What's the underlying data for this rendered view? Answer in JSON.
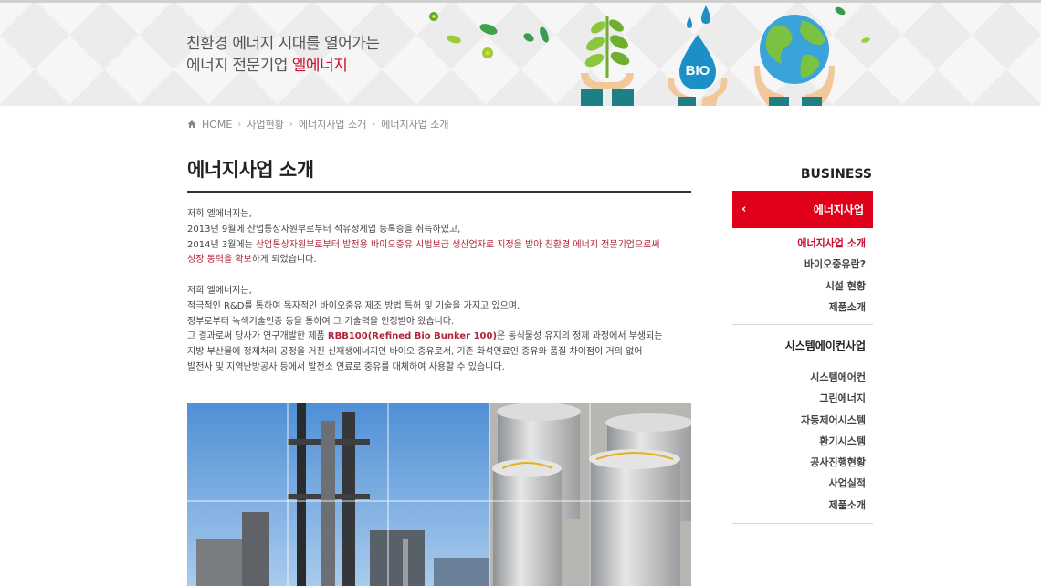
{
  "hero": {
    "tagline_line1": "친환경 에너지 시대를 열어가는",
    "tagline_line2_prefix": "에너지 전문기업 ",
    "tagline_brand": "엘에너지",
    "bio_label": "BIO",
    "colors": {
      "brand_red": "#c8102e",
      "leaf_green": "#5aab2e",
      "drop_blue": "#1b8fc6"
    }
  },
  "breadcrumb": {
    "home": "HOME",
    "items": [
      "사업현황",
      "에너지사업 소개",
      "에너지사업 소개"
    ]
  },
  "main": {
    "title": "에너지사업 소개",
    "para1": {
      "line1": "저희 엘에너지는,",
      "line2": "2013년 9월에 산업통상자원부로부터 석유정제업 등록증을 취득하였고,",
      "line3_prefix": "2014년 3월에는 ",
      "line3_highlight": "산업통상자원부로부터 발전용 바이오중유 시범보급 생산업자로 지정을 받아 친환경 에너지 전문기업으로써",
      "line4_highlight": "성장 동력을 확보",
      "line4_suffix": "하게 되었습니다."
    },
    "para2": {
      "line1": "저희 엘에너지는,",
      "line2": "적극적인 R&D를 통하여 독자적인 바이오중유 제조 방법 특허 및 기술을 가지고 있으며,",
      "line3": "정부로부터 녹색기술인증 등을 통하여 그 기술력을 인정받아 왔습니다.",
      "line4_prefix": "그 결과로써 당사가 연구개발한 제품 ",
      "line4_product": "RBB100(Refined Bio Bunker 100)",
      "line4_suffix": "은 동식물성 유지의 정제 과정에서 부생되는",
      "line5": "지방 부산물에 정제처리 공정을 거친 신재생에너지인 바이오 중유로서, 기존 화석연료인 중유와 품질 차이점이 거의 없어",
      "line6": "발전사 및 지역난방공사 등에서 발전소 연료로 중유를 대체하여 사용할 수 있습니다."
    }
  },
  "sidebar": {
    "heading": "BUSINESS",
    "active_menu": "에너지사업",
    "active_chevron": "‹",
    "energy_items": [
      "에너지사업 소개",
      "바이오중유란?",
      "시설 현황",
      "제품소개"
    ],
    "section2_title": "시스템에이컨사업",
    "system_items": [
      "시스템에어컨",
      "그린에너지",
      "자동제어시스템",
      "환기시스템",
      "공사진행현황",
      "사업실적",
      "제품소개"
    ]
  }
}
